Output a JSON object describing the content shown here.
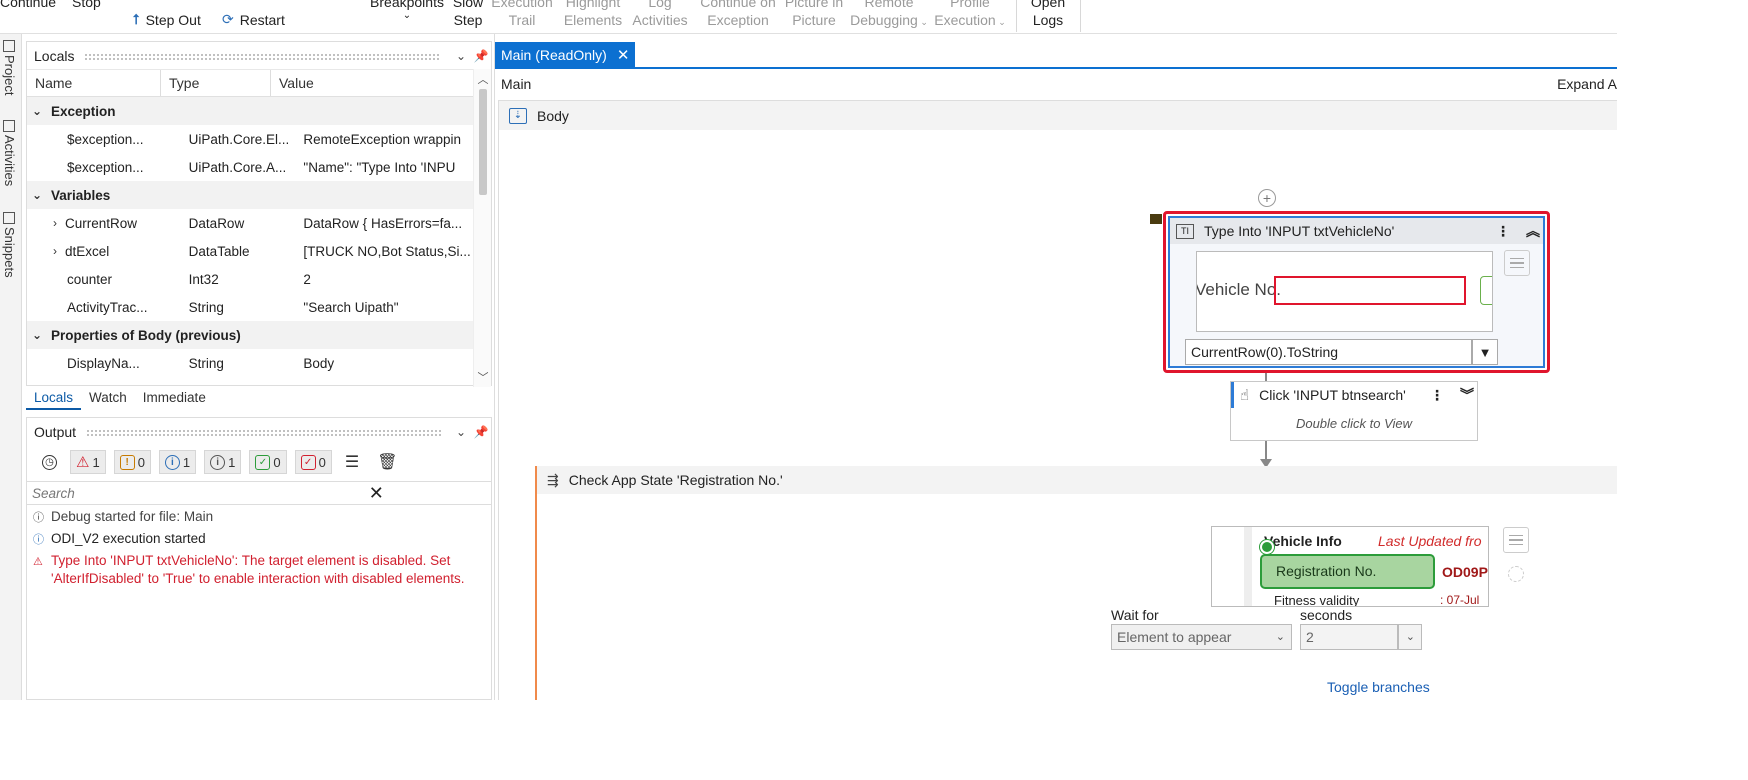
{
  "ribbon": {
    "continue": "Continue",
    "stop": "Stop",
    "step_out": "Step Out",
    "restart": "Restart",
    "breakpoints": "Breakpoints",
    "slow_step_1": "Slow",
    "slow_step_2": "Step",
    "execution_trail_1": "Execution",
    "execution_trail_2": "Trail",
    "highlight_1": "Highlight",
    "highlight_2": "Elements",
    "log_1": "Log",
    "log_2": "Activities",
    "continue_exc_1": "Continue on",
    "continue_exc_2": "Exception",
    "pip_1": "Picture in",
    "pip_2": "Picture",
    "remote_1": "Remote",
    "remote_2": "Debugging",
    "profile_1": "Profile",
    "profile_2": "Execution",
    "open_logs_1": "Open",
    "open_logs_2": "Logs"
  },
  "left_strip": {
    "project": "Project",
    "activities": "Activities",
    "snippets": "Snippets"
  },
  "locals": {
    "title": "Locals",
    "columns": [
      "Name",
      "Type",
      "Value"
    ],
    "groups": {
      "exception": "Exception",
      "variables": "Variables",
      "properties": "Properties of Body (previous)"
    },
    "exception_rows": [
      {
        "name": "$exception...",
        "type": "UiPath.Core.El...",
        "value": "RemoteException wrappin"
      },
      {
        "name": "$exception...",
        "type": "UiPath.Core.A...",
        "value": "  \"Name\": \"Type Into 'INPU"
      }
    ],
    "variable_rows": [
      {
        "name": "CurrentRow",
        "type": "DataRow",
        "value": "DataRow { HasErrors=fa..."
      },
      {
        "name": "dtExcel",
        "type": "DataTable",
        "value": "[TRUCK NO,Bot Status,Si..."
      },
      {
        "name": "counter",
        "type": "Int32",
        "value": "2"
      },
      {
        "name": "ActivityTrac...",
        "type": "String",
        "value": "\"Search Uipath\""
      }
    ],
    "property_rows": [
      {
        "name": "DisplayNa...",
        "type": "String",
        "value": "Body"
      }
    ],
    "tabs": [
      "Locals",
      "Watch",
      "Immediate"
    ]
  },
  "output": {
    "title": "Output",
    "counts": {
      "error": "1",
      "warning": "0",
      "info": "1",
      "trace": "1",
      "success": "0",
      "fail": "0"
    },
    "search_placeholder": "Search",
    "lines": [
      {
        "icon": "ⓘ",
        "text": "Debug started for file: Main",
        "color": "#444444"
      },
      {
        "icon": "ⓘ",
        "text": "ODI_V2 execution started",
        "color": "#222222"
      },
      {
        "icon": "⚠",
        "text": "Type Into 'INPUT  txtVehicleNo': The target element is disabled. Set 'AlterIfDisabled' to 'True' to enable interaction with disabled elements.",
        "color": "#d1202f"
      }
    ]
  },
  "designer": {
    "tab": "Main (ReadOnly)",
    "breadcrumb": "Main",
    "expand_all": "Expand A",
    "body": "Body",
    "type_into": {
      "title": "Type Into 'INPUT  txtVehicleNo'",
      "preview_label": "Vehicle No.",
      "text_value": "CurrentRow(0).ToString"
    },
    "click": {
      "title": "Click 'INPUT  btnsearch'",
      "hint": "Double click to View"
    },
    "check_app_state": {
      "title": "Check App State 'Registration No.'",
      "preview_header": "Vehicle Info",
      "preview_updated": "Last Updated fro",
      "preview_reg": "Registration No.",
      "preview_reg_value": "OD09P",
      "preview_fitness": "Fitness validity",
      "preview_fitness_value": ": 07-Jul",
      "wait_for_label": "Wait for",
      "wait_for_value": "Element to appear",
      "seconds_label": "seconds",
      "seconds_value": "2",
      "toggle": "Toggle branches"
    }
  },
  "colors": {
    "accent": "#0c70d1",
    "error": "#e0152d",
    "success": "#2c9c3a",
    "warning_edge": "#f08a4b"
  }
}
